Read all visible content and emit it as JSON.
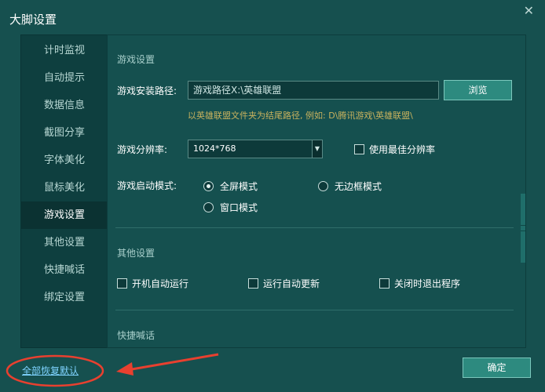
{
  "window": {
    "title": "大脚设置",
    "close_icon": "close-icon"
  },
  "sidebar": {
    "items": [
      {
        "label": "计时监视"
      },
      {
        "label": "自动提示"
      },
      {
        "label": "数据信息"
      },
      {
        "label": "截图分享"
      },
      {
        "label": "字体美化"
      },
      {
        "label": "鼠标美化"
      },
      {
        "label": "游戏设置",
        "active": true
      },
      {
        "label": "其他设置"
      },
      {
        "label": "快捷喊话"
      },
      {
        "label": "绑定设置"
      }
    ]
  },
  "game_settings": {
    "section_title": "游戏设置",
    "install_path_label": "游戏安装路径:",
    "install_path_value": "游戏路径X:\\英雄联盟",
    "browse_label": "浏览",
    "hint": "以英雄联盟文件夹为结尾路径, 例如: D\\腾讯游戏\\英雄联盟\\",
    "resolution_label": "游戏分辨率:",
    "resolution_value": "1024*768",
    "best_resolution_label": "使用最佳分辨率",
    "best_resolution_checked": false,
    "launch_mode_label": "游戏启动模式:",
    "launch_modes": [
      {
        "label": "全屏模式",
        "checked": true
      },
      {
        "label": "无边框模式",
        "checked": false
      },
      {
        "label": "窗口模式",
        "checked": false
      }
    ]
  },
  "other_settings": {
    "section_title": "其他设置",
    "options": [
      {
        "label": "开机自动运行",
        "checked": false
      },
      {
        "label": "运行自动更新",
        "checked": false
      },
      {
        "label": "关闭时退出程序",
        "checked": false
      }
    ]
  },
  "quick_chat": {
    "section_title": "快捷喊话"
  },
  "footer": {
    "restore_label": "全部恢复默认",
    "ok_label": "确定"
  },
  "colors": {
    "annotation": "#e8402f",
    "accent_button": "#2d8a7f",
    "hint": "#c9b25e"
  }
}
